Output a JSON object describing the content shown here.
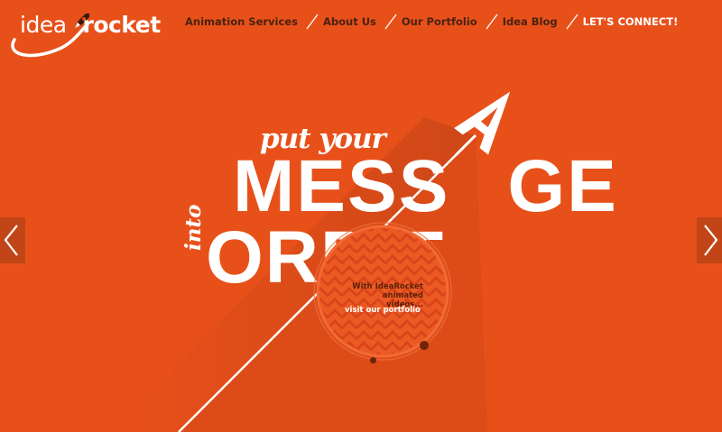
{
  "colors": {
    "background": "#e8501a",
    "nav_text": "#4a2210",
    "white": "#ffffff",
    "dark": "#6e2408"
  },
  "logo": {
    "part1": "idea",
    "part2": "rocket",
    "icon": "rocket-icon"
  },
  "nav": {
    "items": [
      {
        "label": "Animation Services"
      },
      {
        "label": "About Us"
      },
      {
        "label": "Our Portfolio"
      },
      {
        "label": "Idea Blog"
      },
      {
        "label": "LET'S CONNECT!"
      }
    ]
  },
  "hero": {
    "put_your": "put your",
    "message_left": "MESS",
    "message_right": "GE",
    "a_letter": "A",
    "into": "into",
    "orbit": "ORBIT",
    "porthole_text": "With IdeaRocket animated videos...",
    "porthole_line1": "With IdeaRocket",
    "porthole_line2": "animated videos...",
    "visit_link": "visit our portfolio"
  },
  "slider": {
    "prev_icon": "chevron-left-icon",
    "next_icon": "chevron-right-icon"
  }
}
